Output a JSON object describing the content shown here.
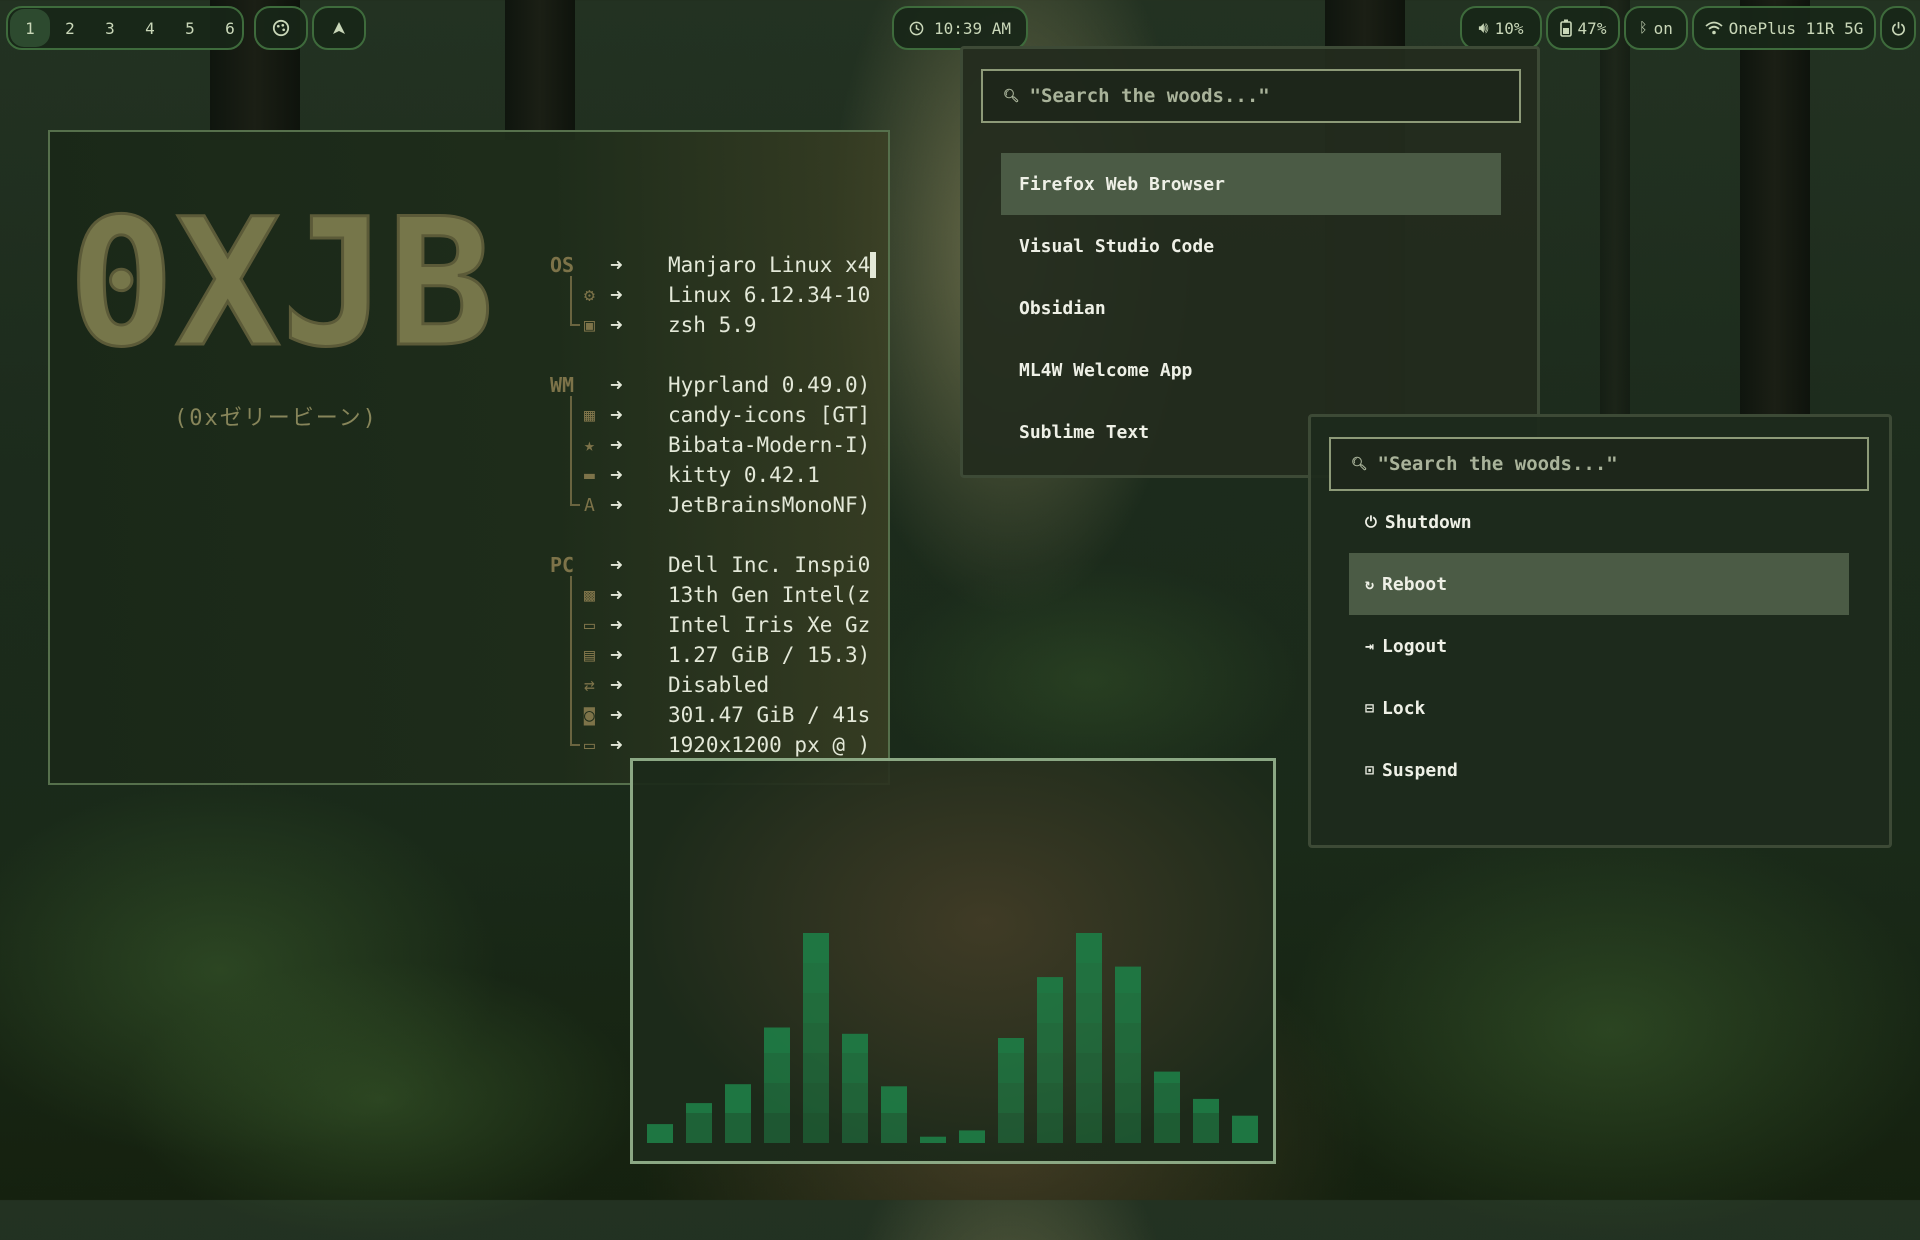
{
  "topbar": {
    "workspaces": [
      "1",
      "2",
      "3",
      "4",
      "5",
      "6"
    ],
    "active_workspace": "1",
    "clock": "10:39 AM",
    "volume": "10%",
    "battery": "47%",
    "bluetooth": "on",
    "wifi": "OnePlus 11R 5G"
  },
  "terminal": {
    "logo_text": "0XJB",
    "logo_subtitle": "(0xゼリービーン)",
    "sections": [
      {
        "key": "OS",
        "rows": [
          {
            "icon": "",
            "value": "Manjaro Linux x4"
          },
          {
            "icon": "gear-icon",
            "value": "Linux 6.12.34-10"
          },
          {
            "icon": "terminal-icon",
            "value": "zsh 5.9"
          }
        ]
      },
      {
        "key": "WM",
        "rows": [
          {
            "icon": "",
            "value": "Hyprland 0.49.0)"
          },
          {
            "icon": "grid-icon",
            "value": "candy-icons [GT]"
          },
          {
            "icon": "star-icon",
            "value": "Bibata-Modern-I)"
          },
          {
            "icon": "console-icon",
            "value": "kitty 0.42.1"
          },
          {
            "icon": "font-icon",
            "value": "JetBrainsMonoNF)"
          }
        ]
      },
      {
        "key": "PC",
        "rows": [
          {
            "icon": "",
            "value": "Dell Inc. Inspi0"
          },
          {
            "icon": "cpu-icon",
            "value": "13th Gen Intel(z"
          },
          {
            "icon": "gpu-icon",
            "value": "Intel Iris Xe Gz"
          },
          {
            "icon": "memory-icon",
            "value": "1.27 GiB / 15.3)"
          },
          {
            "icon": "swap-icon",
            "value": "Disabled"
          },
          {
            "icon": "disk-icon",
            "value": "301.47 GiB / 41s"
          },
          {
            "icon": "display-icon",
            "value": "1920x1200 px @ )"
          }
        ]
      }
    ]
  },
  "launcher": {
    "placeholder": "\"Search the woods...\"",
    "items": [
      "Firefox Web Browser",
      "Visual Studio Code",
      "Obsidian",
      "ML4W Welcome App",
      "Sublime Text"
    ],
    "selected": 0
  },
  "power_menu": {
    "placeholder": "\"Search the woods...\"",
    "items": [
      "Shutdown",
      "Reboot",
      "Logout",
      "Lock",
      "Suspend"
    ],
    "selected": 1
  },
  "visualizer": {
    "levels": [
      0.09,
      0.19,
      0.28,
      0.55,
      1.0,
      0.52,
      0.27,
      0.03,
      0.06,
      0.5,
      0.79,
      1.0,
      0.84,
      0.34,
      0.21,
      0.13
    ]
  },
  "colors": {
    "accent_green": "#3e6b3c",
    "bar_green": "#1f7a44",
    "logo": "#76764a",
    "label_brown": "#7d7349"
  }
}
